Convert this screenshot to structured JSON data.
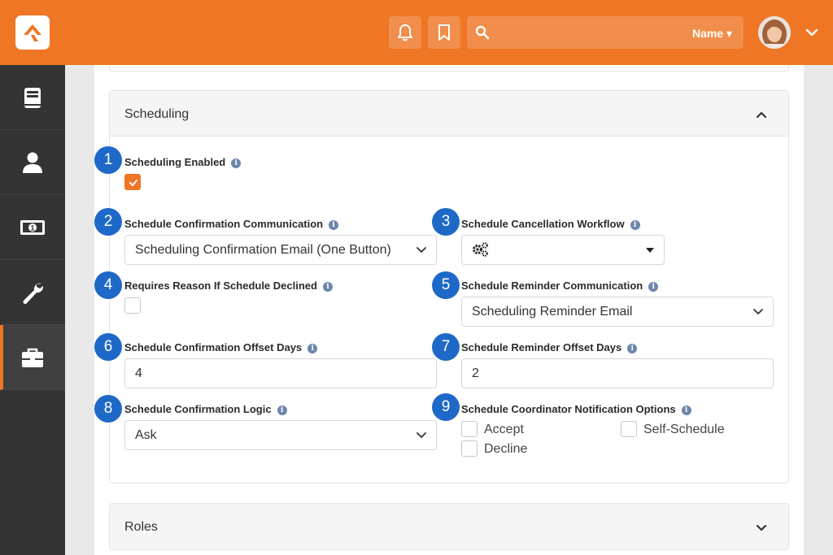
{
  "header": {
    "search_filter_label": "Name",
    "colors": {
      "brand": "#ee7624",
      "badge": "#1e69c8",
      "info": "#6d86ac"
    },
    "icons": [
      "rock-logo-icon",
      "bell-icon",
      "bookmark-icon",
      "search-icon",
      "avatar",
      "chevron-down-icon"
    ]
  },
  "sidebar": {
    "items": [
      {
        "icon": "book-icon"
      },
      {
        "icon": "person-icon"
      },
      {
        "icon": "money-icon"
      },
      {
        "icon": "wrench-icon"
      },
      {
        "icon": "briefcase-icon",
        "active": true
      }
    ]
  },
  "scheduling_panel": {
    "title": "Scheduling",
    "fields": {
      "scheduling_enabled": {
        "badge": "1",
        "label": "Scheduling Enabled",
        "checked": true
      },
      "confirmation_communication": {
        "badge": "2",
        "label": "Schedule Confirmation Communication",
        "value": "Scheduling Confirmation Email (One Button)"
      },
      "cancellation_workflow": {
        "badge": "3",
        "label": "Schedule Cancellation Workflow",
        "value_icon": "gears-icon"
      },
      "requires_reason": {
        "badge": "4",
        "label": "Requires Reason If Schedule Declined",
        "checked": false
      },
      "reminder_communication": {
        "badge": "5",
        "label": "Schedule Reminder Communication",
        "value": "Scheduling Reminder Email"
      },
      "confirmation_offset": {
        "badge": "6",
        "label": "Schedule Confirmation Offset Days",
        "value": "4"
      },
      "reminder_offset": {
        "badge": "7",
        "label": "Schedule Reminder Offset Days",
        "value": "2"
      },
      "confirmation_logic": {
        "badge": "8",
        "label": "Schedule Confirmation Logic",
        "value": "Ask"
      },
      "coordinator_notification": {
        "badge": "9",
        "label": "Schedule Coordinator Notification Options",
        "options": [
          {
            "label": "Accept",
            "checked": false
          },
          {
            "label": "Self-Schedule",
            "checked": false
          },
          {
            "label": "Decline",
            "checked": false
          }
        ]
      }
    }
  },
  "roles_panel": {
    "title": "Roles"
  }
}
